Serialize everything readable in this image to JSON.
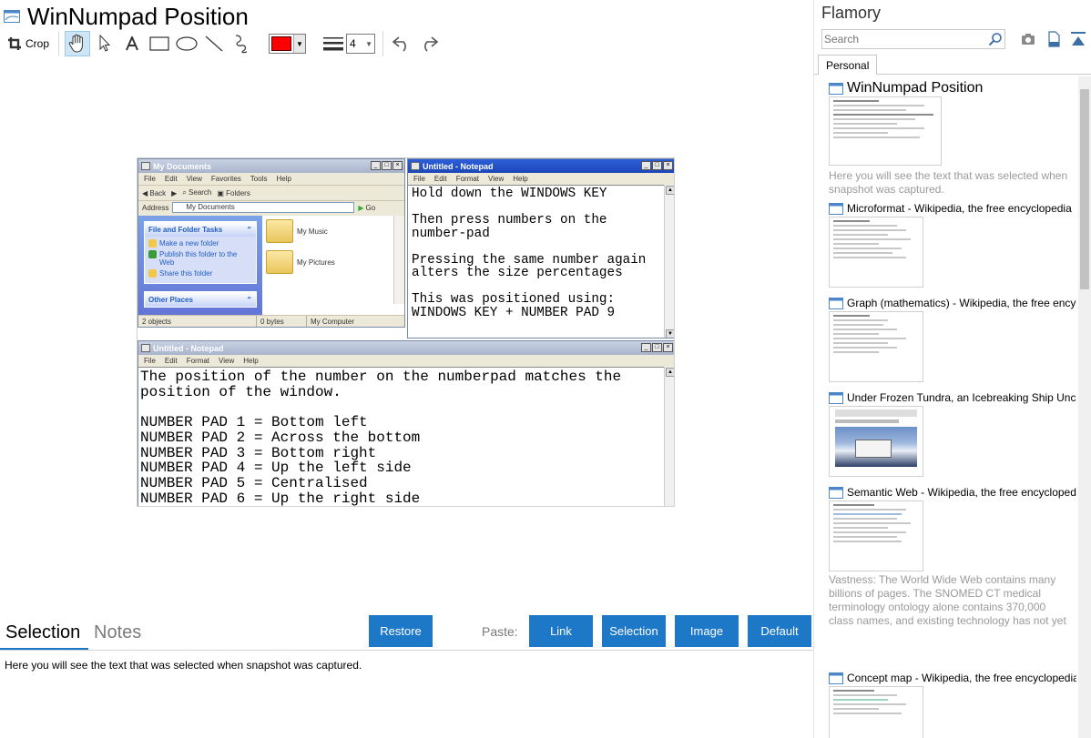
{
  "document": {
    "title": "WinNumpad Position"
  },
  "toolbar": {
    "crop_label": "Crop",
    "line_width_value": "4",
    "color": "#ff0000"
  },
  "snapshot": {
    "explorer": {
      "title": "My Documents",
      "menu": [
        "File",
        "Edit",
        "View",
        "Favorites",
        "Tools",
        "Help"
      ],
      "toolbar": {
        "back": "Back",
        "search": "Search",
        "folders": "Folders"
      },
      "address_label": "Address",
      "address_value": "My Documents",
      "go_label": "Go",
      "tasks_header": "File and Folder Tasks",
      "tasks": [
        "Make a new folder",
        "Publish this folder to the Web",
        "Share this folder"
      ],
      "other_places": "Other Places",
      "items": [
        "My Music",
        "My Pictures"
      ],
      "status": [
        "2 objects",
        "0 bytes",
        "My Computer"
      ]
    },
    "notepad_right": {
      "title": "Untitled - Notepad",
      "menu": [
        "File",
        "Edit",
        "Format",
        "View",
        "Help"
      ],
      "text": "Hold down the WINDOWS KEY\n\nThen press numbers on the\nnumber-pad\n\nPressing the same number again\nalters the size percentages\n\nThis was positioned using:\nWINDOWS KEY + NUMBER PAD 9"
    },
    "notepad_bottom": {
      "title": "Untitled - Notepad",
      "menu": [
        "File",
        "Edit",
        "Format",
        "View",
        "Help"
      ],
      "text": "The position of the number on the numberpad matches the\nposition of the window.\n\nNUMBER PAD 1 = Bottom left\nNUMBER PAD 2 = Across the bottom\nNUMBER PAD 3 = Bottom right\nNUMBER PAD 4 = Up the left side\nNUMBER PAD 5 = Centralised\nNUMBER PAD 6 = Up the right side"
    }
  },
  "bottom": {
    "tabs": {
      "selection": "Selection",
      "notes": "Notes"
    },
    "restore_label": "Restore",
    "paste_label": "Paste:",
    "paste_buttons": {
      "link": "Link",
      "selection": "Selection",
      "image": "Image",
      "default": "Default"
    },
    "selection_text": "Here you will see the text that was selected when snapshot was captured."
  },
  "sidebar": {
    "app_title": "Flamory",
    "search_placeholder": "Search",
    "tab": "Personal",
    "entries": [
      {
        "title": "WinNumpad Position",
        "desc": "Here you will see the text that was selected when snapshot was captured."
      },
      {
        "title": "Microformat - Wikipedia, the free encyclopedia"
      },
      {
        "title": "Graph (mathematics) - Wikipedia, the free encyclopedia"
      },
      {
        "title": "Under Frozen Tundra, an Icebreaking Ship Uncovers Clues"
      },
      {
        "title": "Semantic Web - Wikipedia, the free encyclopedia",
        "desc": "Vastness: The World Wide Web contains many billions of pages. The SNOMED CT medical terminology ontology alone contains 370,000 class names, and existing technology has not yet been able to eliminate all semantically duplicated terms. Any automated reasoning system will have to deal with truly huge inputs."
      },
      {
        "title": "Concept map - Wikipedia, the free encyclopedia"
      }
    ]
  },
  "colors": {
    "accent": "#1e78c8",
    "muted_text": "#9a9a9a"
  }
}
